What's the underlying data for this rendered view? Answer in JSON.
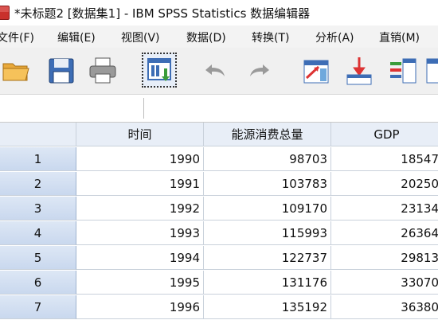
{
  "window": {
    "title": "*未标题2 [数据集1] - IBM SPSS Statistics 数据编辑器"
  },
  "menu": [
    {
      "label": "文件(F)"
    },
    {
      "label": "编辑(E)"
    },
    {
      "label": "视图(V)"
    },
    {
      "label": "数据(D)"
    },
    {
      "label": "转换(T)"
    },
    {
      "label": "分析(A)"
    },
    {
      "label": "直销(M)"
    }
  ],
  "toolbar": {
    "icons": [
      "open-folder-icon",
      "save-icon",
      "print-icon",
      "dialog-recall-icon",
      "undo-icon",
      "redo-icon",
      "goto-case-icon",
      "goto-variable-icon",
      "variables-icon",
      "split-file-icon"
    ]
  },
  "grid": {
    "columns": [
      "时间",
      "能源消费总量",
      "GDP"
    ],
    "rows": [
      {
        "num": "1",
        "cells": [
          "1990",
          "98703",
          "18547"
        ]
      },
      {
        "num": "2",
        "cells": [
          "1991",
          "103783",
          "20250"
        ]
      },
      {
        "num": "3",
        "cells": [
          "1992",
          "109170",
          "23134"
        ]
      },
      {
        "num": "4",
        "cells": [
          "1993",
          "115993",
          "26364"
        ]
      },
      {
        "num": "5",
        "cells": [
          "1994",
          "122737",
          "29813"
        ]
      },
      {
        "num": "6",
        "cells": [
          "1995",
          "131176",
          "33070"
        ]
      },
      {
        "num": "7",
        "cells": [
          "1996",
          "135192",
          "36380"
        ]
      }
    ]
  },
  "colors": {
    "menubar_bg": "#f3f3f3",
    "toolbar_bg": "#f0f0f0",
    "header_bg": "#e8eef7",
    "rowhead_bg": "#c9d8ee"
  }
}
